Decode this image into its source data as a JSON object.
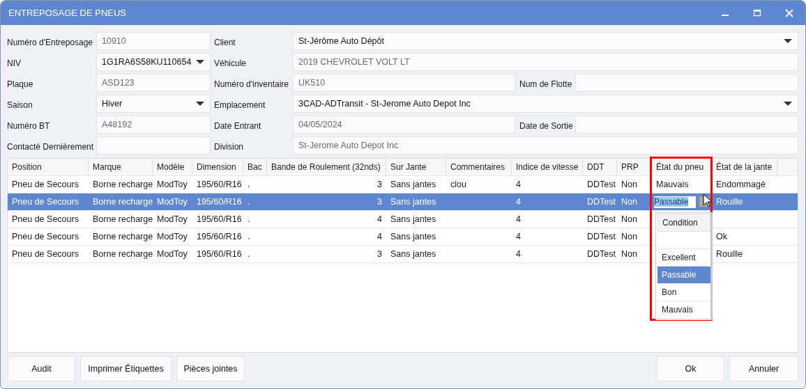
{
  "window": {
    "title": "ENTREPOSAGE DE PNEUS"
  },
  "form": {
    "rows": [
      {
        "fields": [
          {
            "label": "Numéro d'Entreposage",
            "value": "10910",
            "kind": "text",
            "readonly": true
          },
          {
            "label": "Client",
            "value": "St-Jérôme Auto Dépôt",
            "kind": "dropdown",
            "readonly": false
          }
        ]
      },
      {
        "fields": [
          {
            "label": "NIV",
            "value": "1G1RA6S58KU110654",
            "kind": "dropdown",
            "readonly": false
          },
          {
            "label": "Véhicule",
            "value": "2019 CHEVROLET VOLT LT",
            "kind": "text",
            "readonly": true
          }
        ]
      },
      {
        "fields": [
          {
            "label": "Plaque",
            "value": "ASD123",
            "kind": "text",
            "readonly": true
          },
          {
            "label": "Numéro d'inventaire",
            "value": "UK510",
            "kind": "text",
            "readonly": true
          },
          {
            "label": "Num de Flotte",
            "kind": "text"
          }
        ]
      },
      {
        "fields": [
          {
            "label": "Saison",
            "value": "Hiver",
            "kind": "dropdown",
            "readonly": false
          },
          {
            "label": "Emplacement",
            "value": "3CAD-ADTransit - St-Jerome Auto Depot Inc",
            "kind": "dropdown",
            "readonly": false
          }
        ]
      },
      {
        "fields": [
          {
            "label": "Numéro BT",
            "value": "A48192",
            "kind": "text",
            "readonly": true
          },
          {
            "label": "Date Entrant",
            "value": "04/05/2024",
            "kind": "text",
            "readonly": true
          },
          {
            "label": "Date de Sortie",
            "kind": "text"
          }
        ]
      },
      {
        "fields": [
          {
            "label": "Contacté Dernièrement",
            "kind": "text"
          },
          {
            "label": "Division",
            "value": "St-Jerome Auto Depot Inc",
            "kind": "text",
            "readonly": true
          }
        ]
      }
    ]
  },
  "table": {
    "columns": [
      {
        "label": "Position",
        "kind": "text",
        "highlighted": false
      },
      {
        "label": "Marque",
        "kind": "text",
        "highlighted": false
      },
      {
        "label": "Modèle",
        "kind": "text",
        "highlighted": false
      },
      {
        "label": "Dimension",
        "kind": "text",
        "highlighted": false
      },
      {
        "label": "Bac",
        "kind": "text",
        "highlighted": false
      },
      {
        "label": "Bande de Roulement (32nds)",
        "kind": "number",
        "highlighted": false
      },
      {
        "label": "Sur Jante",
        "kind": "text",
        "highlighted": false
      },
      {
        "label": "Commentaires",
        "kind": "text",
        "highlighted": false
      },
      {
        "label": "Indice de vitesse",
        "kind": "text",
        "highlighted": false
      },
      {
        "label": "DDT",
        "kind": "text",
        "highlighted": false
      },
      {
        "label": "PRP",
        "kind": "text",
        "highlighted": false
      },
      {
        "label": "État du pneu",
        "kind": "text",
        "highlighted": true
      },
      {
        "label": "État de la jante",
        "kind": "text",
        "highlighted": false
      }
    ],
    "rows": [
      {
        "selected": false,
        "cells": [
          "Pneu de Secours",
          "Borne recharge",
          "ModToy",
          "195/60/R16",
          ".",
          "3",
          "Sans jantes",
          "clou",
          "4",
          "DDTest",
          "Non",
          "Mauvais",
          "Endommagé"
        ]
      },
      {
        "selected": true,
        "cells": [
          "Pneu de Secours",
          "Borne recharge",
          "ModToy",
          "195/60/R16",
          ".",
          "3",
          "Sans jantes",
          null,
          "4",
          "DDTest",
          "Non",
          {
            "kind": "editor",
            "value": "Passable",
            "text_selected": true
          },
          "Rouille"
        ]
      },
      {
        "selected": false,
        "cells": [
          "Pneu de Secours",
          "Borne recharge",
          "ModToy",
          "195/60/R16",
          ".",
          "4",
          "Sans jantes",
          null,
          "4",
          "DDTest",
          "Non",
          null,
          null
        ]
      },
      {
        "selected": false,
        "cells": [
          "Pneu de Secours",
          "Borne recharge",
          "ModToy",
          "195/60/R16",
          ".",
          "4",
          "Sans jantes",
          null,
          "4",
          "DDTest",
          "Non",
          null,
          "Ok"
        ]
      },
      {
        "selected": false,
        "cells": [
          "Pneu de Secours",
          "Borne recharge",
          "ModToy",
          "195/60/R16",
          ".",
          "3",
          "Sans jantes",
          null,
          "4",
          "DDTest",
          "Non",
          null,
          "Rouille"
        ]
      }
    ],
    "dropdown": {
      "header": "Condition",
      "options": [
        {
          "kind": "blank",
          "selected": false
        },
        {
          "kind": "option",
          "label": "Excellent",
          "selected": false
        },
        {
          "kind": "option",
          "label": "Passable",
          "selected": true
        },
        {
          "kind": "option",
          "label": "Bon",
          "selected": false
        },
        {
          "kind": "option",
          "label": "Mauvais",
          "selected": false
        }
      ]
    }
  },
  "buttons": {
    "left": [
      "Audit",
      "Imprimer Étiquettes",
      "Pièces jointes"
    ],
    "right": [
      "Ok",
      "Annuler"
    ]
  }
}
